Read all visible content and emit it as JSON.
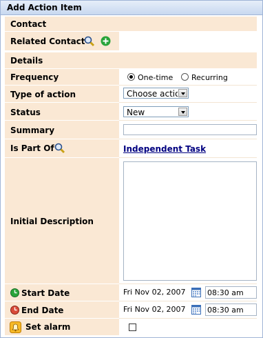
{
  "title": "Add Action Item",
  "sections": {
    "contact": "Contact",
    "details": "Details"
  },
  "labels": {
    "related_contact": "Related Contact",
    "frequency": "Frequency",
    "type_of_action": "Type of action",
    "status": "Status",
    "summary": "Summary",
    "is_part_of": "Is Part Of",
    "initial_description": "Initial Description",
    "start_date": "Start Date",
    "end_date": "End Date",
    "set_alarm": "Set alarm"
  },
  "frequency": {
    "options": [
      "One-time",
      "Recurring"
    ],
    "selected": "One-time"
  },
  "type_of_action": {
    "value": "Choose action"
  },
  "status": {
    "value": "New"
  },
  "is_part_of": {
    "link": "Independent Task"
  },
  "start": {
    "date": "Fri Nov 02, 2007",
    "time": "08:30 am"
  },
  "end": {
    "date": "Fri Nov 02, 2007",
    "time": "08:30 am"
  },
  "icons": {
    "search": "magnifier-icon",
    "add": "green-plus-icon",
    "calendar": "calendar-icon",
    "start": "green-clock-icon",
    "end": "red-clock-icon",
    "alarm": "alarm-bell-icon"
  },
  "colors": {
    "label_bg": "#fae8d4",
    "border": "#9fb4d6",
    "link": "#000080"
  }
}
